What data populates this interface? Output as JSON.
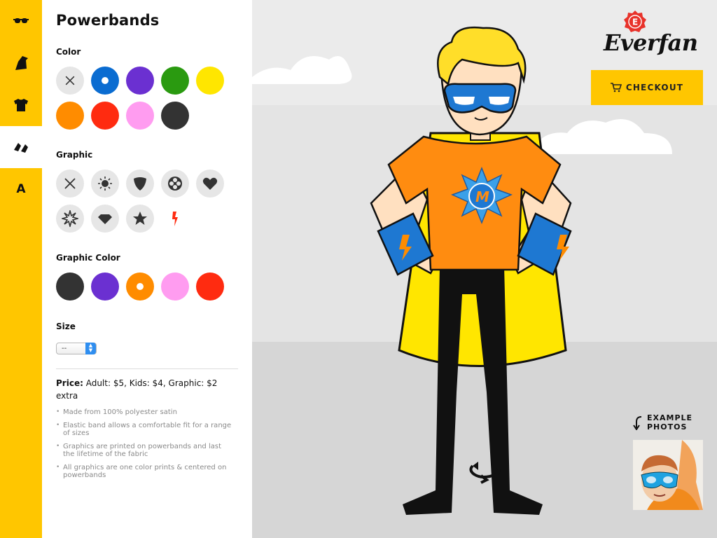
{
  "rail": {
    "items": [
      {
        "name": "glasses-icon"
      },
      {
        "name": "cape-icon"
      },
      {
        "name": "tshirt-icon"
      },
      {
        "name": "powerbands-icon",
        "active": true
      },
      {
        "name": "letter-icon",
        "letter": "A"
      }
    ]
  },
  "panel": {
    "title": "Powerbands",
    "color_label": "Color",
    "colors": [
      "none",
      "#0a6cd1",
      "#6b30d1",
      "#2a9a10",
      "#ffe600",
      "#ff8c00",
      "#ff2b10",
      "#ff9cf0",
      "#333333"
    ],
    "selected_color": "#0a6cd1",
    "graphic_label": "Graphic",
    "graphics": [
      "none-icon",
      "sun-icon",
      "shield-icon",
      "flower-icon",
      "heart-icon",
      "burst-icon",
      "diamond-icon",
      "star-icon",
      "lightning-icon"
    ],
    "graphic_color_label": "Graphic Color",
    "graphic_colors": [
      "#333333",
      "#6b30d1",
      "#ff8c00",
      "#ff9cf0",
      "#ff2b10"
    ],
    "selected_graphic_color": "#ff8c00",
    "size_label": "Size",
    "size_value": "--",
    "price_label": "Price:",
    "price_text": " Adult: $5, Kids: $4, Graphic: $2 extra",
    "features": [
      "Made from 100% polyester satin",
      "Elastic band allows a comfortable fit for a range of sizes",
      "Graphics are printed on powerbands and last the lifetime of the fabric",
      "All graphics are one color prints & centered on powerbands"
    ]
  },
  "header": {
    "logo_text": "Everfan",
    "logo_badge_letter": "E",
    "checkout_label": "CHECKOUT"
  },
  "stage": {
    "example_line1": "EXAMPLE",
    "example_line2": "PHOTOS",
    "hero_colors": {
      "hair": "#ffde29",
      "mask": "#1e78d2",
      "shirt": "#ff8c10",
      "cape": "#ffe600",
      "pants": "#111111",
      "band": "#1e78d2",
      "band_graphic": "#ff8c00",
      "skin": "#ffe0c0"
    }
  }
}
